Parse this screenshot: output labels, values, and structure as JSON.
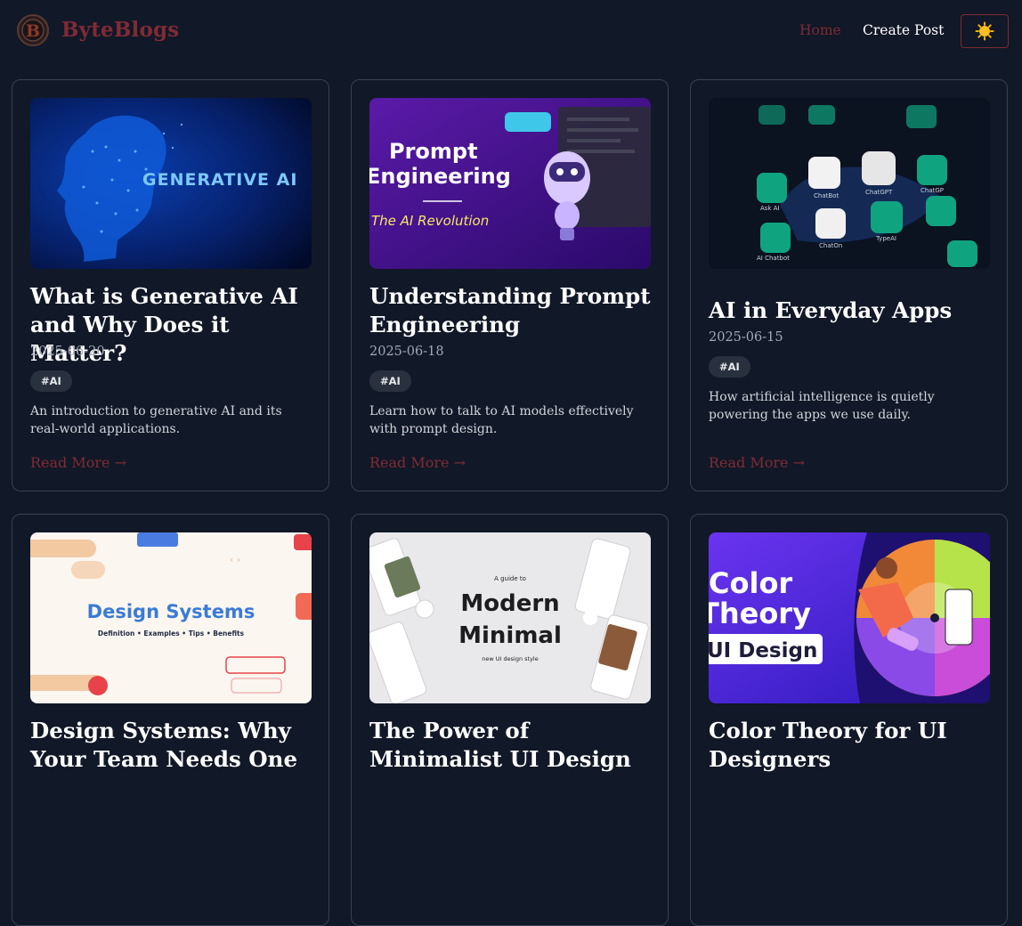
{
  "header": {
    "brand": "ByteBlogs",
    "logo_letter": "B",
    "nav": {
      "home": "Home",
      "create_post": "Create Post"
    },
    "theme_icon": "sun-icon"
  },
  "colors": {
    "background": "#111827",
    "accent": "#7f2b35",
    "card_border": "#3a4252",
    "tag_bg": "#2a313e",
    "muted_text": "#a2a8b3"
  },
  "posts": [
    {
      "title": "What is Generative AI and Why Does it Matter?",
      "date": "2025-06-20",
      "tag": "#AI",
      "excerpt": "An introduction to generative AI and its real-world applications.",
      "read_more": "Read More →",
      "image_text": "GENERATIVE AI"
    },
    {
      "title": "Understanding Prompt Engineering",
      "date": "2025-06-18",
      "tag": "#AI",
      "excerpt": "Learn how to talk to AI models effectively with prompt design.",
      "read_more": "Read More →",
      "image_text": "Prompt",
      "image_text_2": "Engineering",
      "image_subtext": "The AI Revolution"
    },
    {
      "title": "AI in Everyday Apps",
      "date": "2025-06-15",
      "tag": "#AI",
      "excerpt": "How artificial intelligence is quietly powering the apps we use daily.",
      "read_more": "Read More →",
      "image_labels": [
        "ChatBot",
        "ChatGPT",
        "ChatGP",
        "Ask AI",
        "AI Chatbot",
        "ChatOn",
        "TypeAI"
      ]
    },
    {
      "title": "Design Systems: Why Your Team Needs One",
      "image_text": "Design Systems",
      "image_subtext": "Definition  •  Examples  •  Tips  •  Benefits"
    },
    {
      "title": "The Power of Minimalist UI Design",
      "image_kicker": "A guide to",
      "image_text": "Modern",
      "image_text_2": "Minimal",
      "image_subtext": "new UI design style"
    },
    {
      "title": "Color Theory for UI Designers",
      "image_text": "Color",
      "image_text_2": "Theory",
      "image_subtext": "UI Design"
    }
  ]
}
